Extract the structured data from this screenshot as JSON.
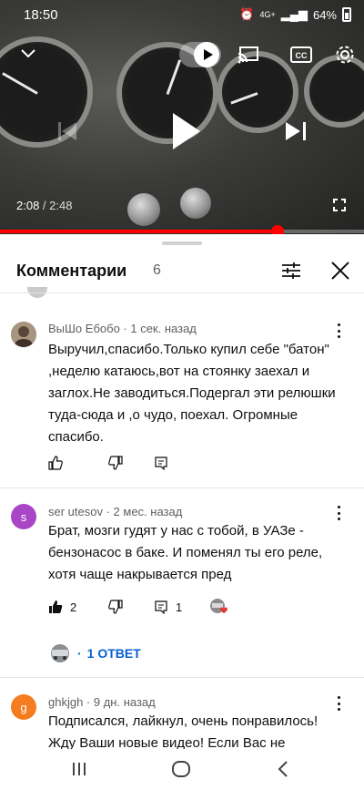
{
  "status_bar": {
    "time": "18:50",
    "network": "4G+",
    "battery": "64%"
  },
  "player": {
    "current_time": "2:08",
    "duration": "2:48",
    "progress": 0.762,
    "icons": [
      "chevron-down-icon",
      "autoplay-toggle",
      "cast-icon",
      "captions-icon",
      "settings-icon",
      "play-icon",
      "previous-icon",
      "next-icon",
      "fullscreen-icon"
    ]
  },
  "comments_panel": {
    "title": "Комментарии",
    "count": "6"
  },
  "comments": [
    {
      "author": "ВыШо Ебобо",
      "time": "1 сек. назад",
      "text": "Выручил,спасибо.Только купил себе \"батон\" ,неделю катаюсь,вот на стоянку заехал и заглох.Не заводиться.Подергал эти релюшки туда-сюда и ,о чудо, поехал. Огромные спасибо.",
      "likes": "",
      "replies": ""
    },
    {
      "author": "ser utesov",
      "avatar_letter": "s",
      "avatar_color": "#a846c6",
      "time": "2 мес. назад",
      "text": "Брат, мозги гудят у нас с тобой, в УАЗе - бензонасос в баке. И поменял ты его реле, хотя чаще накрывается пред",
      "likes": "2",
      "replies": "1",
      "reply_link": "1 ОТВЕТ"
    },
    {
      "author": "ghkjgh",
      "avatar_letter": "g",
      "avatar_color": "#f57c1f",
      "time": "9 дн. назад",
      "text": "Подписался, лайкнул, очень понравилось! Жду Ваши новые видео! Если Вас не"
    }
  ],
  "colors": {
    "accent_red": "#ff0000",
    "link_blue": "#065fd4",
    "meta_gray": "#606060"
  }
}
